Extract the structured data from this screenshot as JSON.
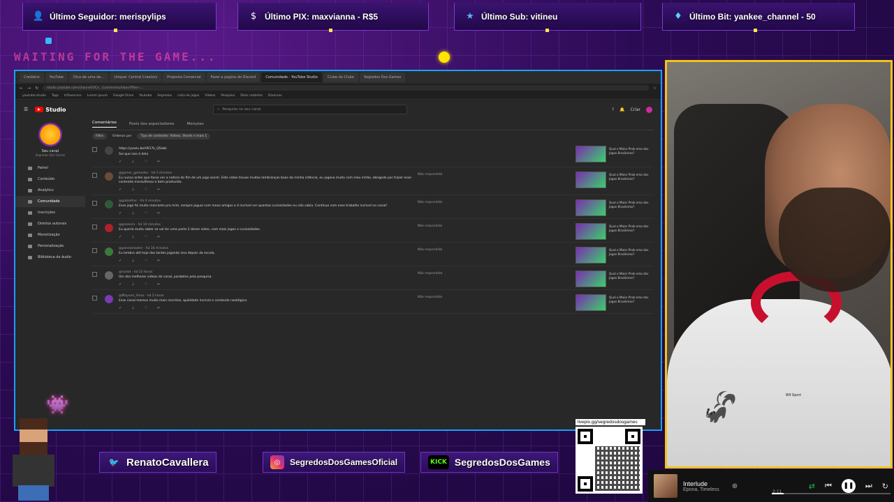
{
  "alerts": {
    "follower": "Último Seguidor: merispylips",
    "pix": "Último PIX: maxvianna - R$5",
    "sub": "Último Sub: vitineu",
    "bit": "Último Bit: yankee_channel - 50"
  },
  "waiting_text": "WAITING FOR THE GAME...",
  "browser": {
    "tabs": [
      "Crediário",
      "YouTube",
      "Dica de uma de...",
      "Unique: Central Creators",
      "Proposta Comercial",
      "Fazer a pagina do Discord",
      "Comunidade - YouTube Studio",
      "Clube do Clube",
      "Segredos Dos Games"
    ],
    "url": "studio.youtube.com/channel/UCx.../comments/inbox?filter=...",
    "bookmarks": [
      "youtube:studio",
      "Tags",
      "Influencers",
      "Lorem ipsum",
      "Google Drive",
      "Youtube",
      "Segredos",
      "Lista de jogos",
      "Vídeos",
      "Pesquisa",
      "Sites cadastro",
      "Diversos"
    ]
  },
  "studio": {
    "logo_text": "Studio",
    "search_placeholder": "Pesquise no seu canal",
    "create_label": "Criar",
    "channel_name": "Seu canal",
    "channel_sub": "Segredos Dos Games",
    "nav": [
      "Painel",
      "Conteúdo",
      "Analytics",
      "Comunidade",
      "Inscrições",
      "Direitos autorais",
      "Monetização",
      "Personalização",
      "Biblioteca de áudio"
    ],
    "subtabs": [
      "Comentários",
      "Posts dos espectadores",
      "Menções"
    ],
    "filters": [
      "Filtro",
      "Ordenar por",
      "Tipo de conteúdo: Vídeos, Shorts e mais 1"
    ],
    "comments": [
      {
        "meta": "",
        "text": "https://youtu.be/VK17k_Q5obk",
        "extra": "Sei que isso é dela",
        "status": ""
      },
      {
        "meta": "@gamer_gamedev · há 3 minutos",
        "text": "Eu nunca achei que fosse ver a notícia do fim de um jogo assim. Este vídeo trouxe muitas lembranças boas da minha infância, eu jogava muito com meu irmão, obrigado por trazer esse conteúdo maravilhoso e bem produzido.",
        "extra": "",
        "status": "Não respondido"
      },
      {
        "meta": "@gabiethor · há 4 minutos",
        "text": "Esse jogo foi muito marcante pra mim, sempre joguei com meus amigos e é incrível ver quantas curiosidades eu não sabia. Continue com esse trabalho incrível no canal!",
        "extra": "",
        "status": "Não respondido"
      },
      {
        "meta": "@gnosisrx · há 10 minutos",
        "text": "Eu queria muito saber se vai ter uma parte 2 desse vídeo, com mais jogos e curiosidades.",
        "extra": "",
        "status": "Não respondido"
      },
      {
        "meta": "@pandamaster · há 16 minutos",
        "text": "Eu lembro até hoje das tardes jogando isso depois da escola.",
        "extra": "",
        "status": "Não respondido"
      },
      {
        "meta": "@ruslot · há 23 horas",
        "text": "Um dos melhores vídeos do canal, parabéns pela pesquisa.",
        "extra": "",
        "status": "Não respondido"
      },
      {
        "meta": "@Mayumi_limas · há 2 horas",
        "text": "Esse canal merece muito mais inscritos, qualidade incrível e conteúdo nostálgico.",
        "extra": "",
        "status": "Não respondido"
      }
    ],
    "video_title": "Qual o Maior Prob ema dos Jogos Brasileiros?"
  },
  "socials": {
    "twitter": "RenatoCavallera",
    "instagram": "SegredosDosGamesOficial",
    "kick_logo": "KICK",
    "kick": "SegredosDosGames"
  },
  "qr_label": "livepix.gg/segredosdosgames",
  "player": {
    "title": "Interlude",
    "artist": "Epona, Timeless",
    "time": "2:11",
    "progress": 0.1
  },
  "cam": {
    "brand": "W4 Sport"
  }
}
